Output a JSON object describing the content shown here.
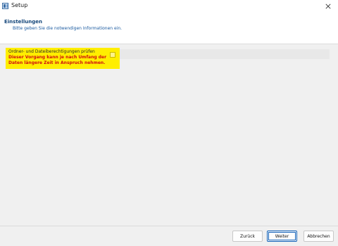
{
  "window": {
    "title": "Setup"
  },
  "header": {
    "title": "Einstellungen",
    "subtitle": "Bitte geben Sie die notwendigen Informationen ein."
  },
  "option": {
    "label": "Ordner- und Dateiberechtigungen prüfen",
    "checked": false,
    "warning": "Dieser Vorgang kann je nach Umfang der\nDaten längere Zeit in Anspruch nehmen.",
    "highlight_color": "#ffee00",
    "warning_color": "#d01010"
  },
  "buttons": {
    "back": "Zurück",
    "next": "Weiter",
    "cancel": "Abbrechen"
  }
}
